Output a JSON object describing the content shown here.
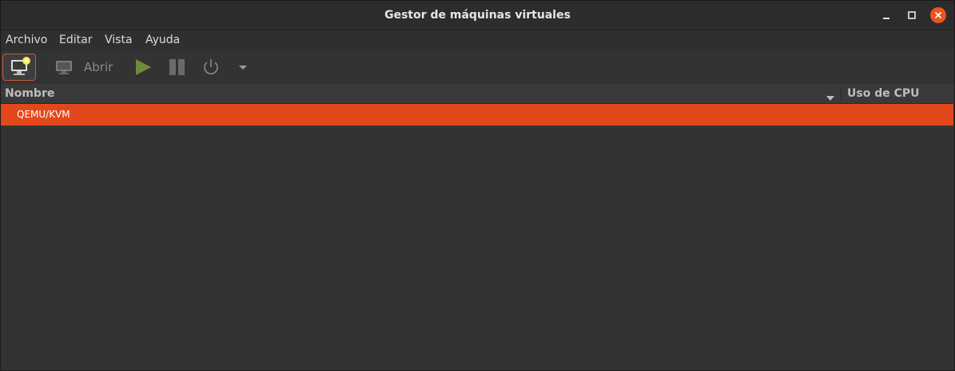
{
  "window": {
    "title": "Gestor de máquinas virtuales"
  },
  "menubar": {
    "items": [
      {
        "label": "Archivo"
      },
      {
        "label": "Editar"
      },
      {
        "label": "Vista"
      },
      {
        "label": "Ayuda"
      }
    ]
  },
  "toolbar": {
    "new_icon": "new-vm-monitor-icon",
    "open_label": "Abrir",
    "open_icon": "monitor-icon",
    "run_icon": "play-icon",
    "pause_icon": "pause-icon",
    "power_icon": "power-icon",
    "dropdown_icon": "triangle-down-icon"
  },
  "list": {
    "columns": [
      {
        "label": "Nombre"
      },
      {
        "label": "Uso de CPU"
      }
    ],
    "rows": [
      {
        "name": "QEMU/KVM",
        "selected": true
      }
    ]
  },
  "colors": {
    "accent": "#e95420",
    "selection": "#e2481c",
    "background": "#333333"
  }
}
